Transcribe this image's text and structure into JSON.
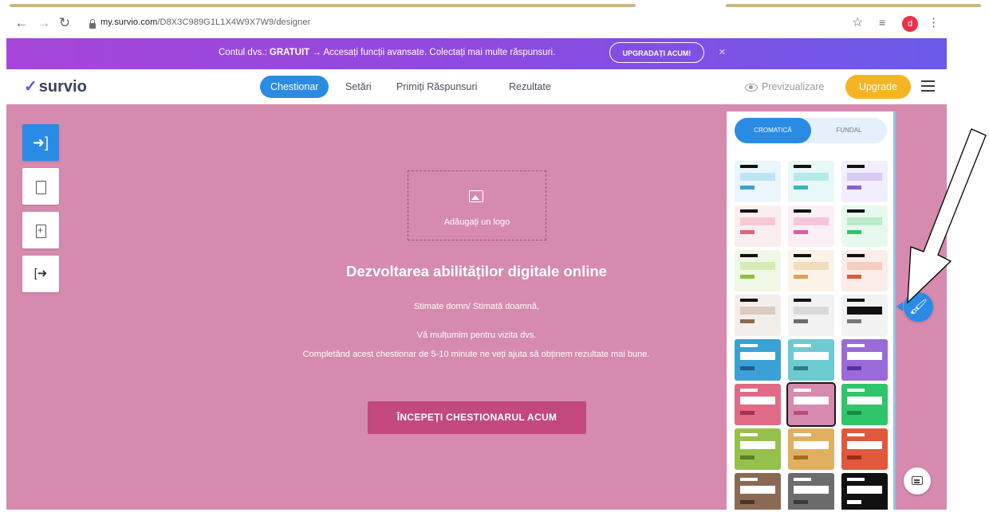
{
  "browser": {
    "url_host": "my.survio.com",
    "url_path": "/D8X3C989G1L1X4W9X7W9/designer",
    "profile_initial": "d"
  },
  "promo": {
    "text_prefix": "Contul dvs.: ",
    "plan": "GRATUIT",
    "text_suffix": " → Accesați funcții avansate. Colectați mai multe răspunsuri.",
    "button": "UPGRADAȚI ACUM!",
    "close": "×"
  },
  "header": {
    "logo": "survio",
    "tabs": [
      "Chestionar",
      "Setări",
      "Primiți Răspunsuri",
      "Rezultate"
    ],
    "active_tab": "Chestionar",
    "preview": "Previzualizare",
    "upgrade": "Upgrade"
  },
  "toolbar": {
    "tools": [
      "sign-in-icon",
      "page-icon",
      "add-page-icon",
      "sign-out-icon"
    ]
  },
  "survey": {
    "logo_placeholder": "Adăugați un logo",
    "title": "Dezvoltarea abilităților digitale online",
    "greeting": "Stimate domn/ Stimată doamnă,",
    "intro_line1": "Vă mulțumim pentru vizita dvs.",
    "intro_line2": "Completând acest chestionar de 5-10 minute ne veți ajuta să obținem rezultate mai bune.",
    "start_button": "ÎNCEPEȚI CHESTIONARUL ACUM"
  },
  "theme_panel": {
    "tab_colors": "CROMATICĂ",
    "tab_background": "FUNDAL",
    "active_tab": "CROMATICĂ",
    "themes": [
      {
        "style": "light",
        "bg": "#eaf6fb",
        "band": "#bde6f5",
        "bar": "#3aa1d4"
      },
      {
        "style": "light",
        "bg": "#e8f7f7",
        "band": "#b6e9ec",
        "bar": "#37b5bd"
      },
      {
        "style": "light",
        "bg": "#f2eefb",
        "band": "#d9c9f5",
        "bar": "#8a5fd6"
      },
      {
        "style": "light",
        "bg": "#fbeef1",
        "band": "#f6c9d4",
        "bar": "#e0617c"
      },
      {
        "style": "light",
        "bg": "#fbeef5",
        "band": "#f6c5dc",
        "bar": "#d7609b"
      },
      {
        "style": "light",
        "bg": "#e8f8ee",
        "band": "#b8ecca",
        "bar": "#2fc56a"
      },
      {
        "style": "light",
        "bg": "#f1f7e6",
        "band": "#d5ebb3",
        "bar": "#8dbf3c"
      },
      {
        "style": "light",
        "bg": "#fbf3e8",
        "band": "#f3dcb9",
        "bar": "#d9a355"
      },
      {
        "style": "light",
        "bg": "#fbede9",
        "band": "#f6cdc1",
        "bar": "#e0593c"
      },
      {
        "style": "light",
        "bg": "#f4eeea",
        "band": "#dcccc0",
        "bar": "#8a6a55"
      },
      {
        "style": "light",
        "bg": "#f2f2f2",
        "band": "#d9d9d9",
        "bar": "#6c6c6c"
      },
      {
        "style": "light",
        "bg": "#f2f2f2",
        "band": "#111111",
        "bar": "#777777"
      },
      {
        "style": "solid",
        "bg": "#3aa1d4",
        "band": "#ffffff",
        "bar": "#1f5f8a"
      },
      {
        "style": "solid",
        "bg": "#6ccad0",
        "band": "#ffffff",
        "bar": "#2b7d83"
      },
      {
        "style": "solid",
        "bg": "#9a6ad8",
        "band": "#ffffff",
        "bar": "#5b2fa0"
      },
      {
        "style": "solid",
        "bg": "#e06b86",
        "band": "#ffffff",
        "bar": "#a83150"
      },
      {
        "style": "solid",
        "bg": "#d58aae",
        "band": "#ffffff",
        "bar": "#b44e80",
        "selected": true
      },
      {
        "style": "solid",
        "bg": "#2fc56a",
        "band": "#ffffff",
        "bar": "#168a44"
      },
      {
        "style": "solid",
        "bg": "#96c04c",
        "band": "#ffffff",
        "bar": "#5c7f22"
      },
      {
        "style": "solid",
        "bg": "#e0b060",
        "band": "#ffffff",
        "bar": "#9f6e20"
      },
      {
        "style": "solid",
        "bg": "#e0593c",
        "band": "#ffffff",
        "bar": "#9c2a14"
      },
      {
        "style": "solid",
        "bg": "#8a6a55",
        "band": "#ffffff",
        "bar": "#4e3426"
      },
      {
        "style": "solid",
        "bg": "#6c6c6c",
        "band": "#ffffff",
        "bar": "#3a3a3a"
      },
      {
        "style": "solid",
        "bg": "#111111",
        "band": "#ffffff",
        "bar": "#ffffff"
      }
    ]
  },
  "floating": {
    "theme_button_icon": "paint-brush-icon",
    "chat_button_icon": "chat-icon"
  },
  "colors": {
    "accent": "#2a8be5",
    "canvas": "#d58aae",
    "start_button": "#c2487e",
    "upgrade": "#f6b424"
  }
}
